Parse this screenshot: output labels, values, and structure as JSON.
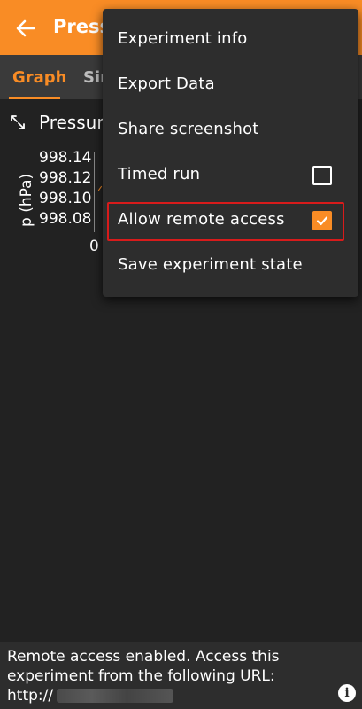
{
  "appbar": {
    "title": "Pressure",
    "back_icon": "arrow-left-icon",
    "color": "#f98c25"
  },
  "tabs": [
    {
      "label": "Graph",
      "active": true
    },
    {
      "label": "Simple",
      "active": false
    }
  ],
  "graph": {
    "title": "Pressure",
    "expand_icon": "expand-icon",
    "ylabel": "p (hPa)",
    "yticks": [
      "998.14",
      "998.12",
      "998.10",
      "998.08"
    ],
    "xtick": "0"
  },
  "menu": {
    "items": [
      {
        "label": "Experiment info"
      },
      {
        "label": "Export Data"
      },
      {
        "label": "Share screenshot"
      },
      {
        "label": "Timed run",
        "checkbox": false
      },
      {
        "label": "Allow remote access",
        "checkbox": true
      },
      {
        "label": "Save experiment state"
      }
    ],
    "highlight_color": "#d81b1b"
  },
  "status": {
    "message": "Remote access enabled. Access this experiment from the following URL:",
    "url_prefix": "http://",
    "info_icon": "info-icon"
  }
}
